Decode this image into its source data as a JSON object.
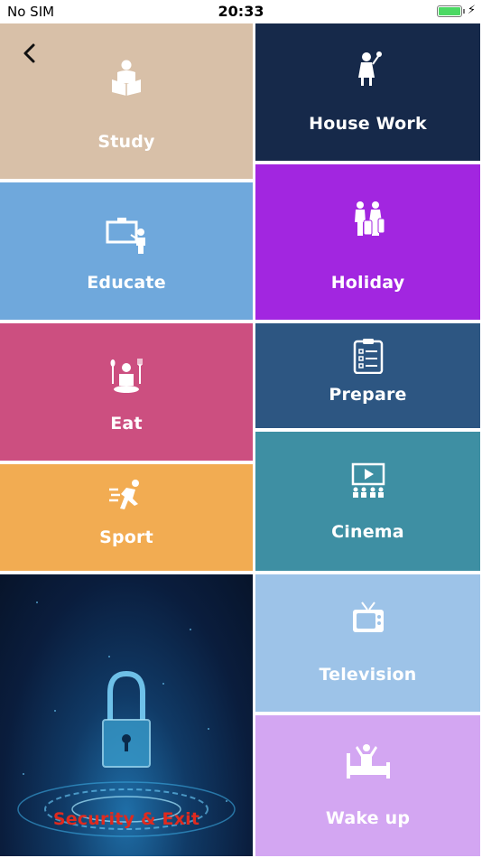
{
  "status_bar": {
    "carrier": "No SIM",
    "time": "20:33",
    "battery_color": "#4cd964"
  },
  "nav": {
    "back_icon": "chevron-left-icon"
  },
  "tiles": [
    {
      "key": "study",
      "label": "Study",
      "color": "#d8c0a8",
      "icon": "reading-person-icon"
    },
    {
      "key": "house_work",
      "label": "House Work",
      "color": "#16294a",
      "icon": "housekeeper-icon"
    },
    {
      "key": "educate",
      "label": "Educate",
      "color": "#6fa8dc",
      "icon": "teacher-board-icon"
    },
    {
      "key": "holiday",
      "label": "Holiday",
      "color": "#a226e0",
      "icon": "travelers-luggage-icon"
    },
    {
      "key": "eat",
      "label": "Eat",
      "color": "#cc4f80",
      "icon": "dining-icon"
    },
    {
      "key": "prepare",
      "label": "Prepare",
      "color": "#2d5682",
      "icon": "checklist-clipboard-icon"
    },
    {
      "key": "sport",
      "label": "Sport",
      "color": "#f2ac52",
      "icon": "running-person-icon"
    },
    {
      "key": "cinema",
      "label": "Cinema",
      "color": "#3e8fa3",
      "icon": "cinema-screen-icon"
    },
    {
      "key": "security",
      "label": "Security & Exit",
      "color": "#e02a1e",
      "icon": "padlock-icon"
    },
    {
      "key": "television",
      "label": "Television",
      "color": "#9dc3e8",
      "icon": "tv-icon"
    },
    {
      "key": "wake_up",
      "label": "Wake up",
      "color": "#d3a6f2",
      "icon": "bed-wakeup-icon"
    }
  ]
}
